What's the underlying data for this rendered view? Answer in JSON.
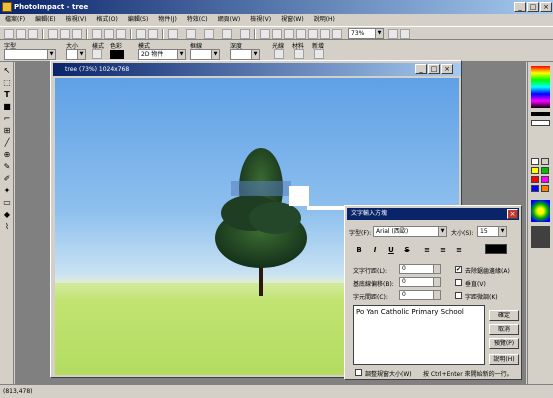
{
  "app": {
    "title": "PhotoImpact - tree",
    "menu": [
      "檔案(F)",
      "編輯(E)",
      "檢視(V)",
      "格式(O)",
      "編輯(S)",
      "物件(J)",
      "特效(C)",
      "網頁(W)",
      "檢視(V)",
      "視窗(W)",
      "說明(H)"
    ]
  },
  "toolbar": {
    "zoom": "73%"
  },
  "propbar": {
    "labels": [
      "字型",
      "大小",
      "樣式",
      "色彩",
      "模式",
      "框線",
      "深度",
      "光線",
      "材料",
      "新增"
    ],
    "mode_value": "2D 物件"
  },
  "document": {
    "title": "tree (73%) 1024x768"
  },
  "dialog": {
    "title": "文字輸入方塊",
    "font_label": "字型(F):",
    "font_value": "Arial (西歐)",
    "size_label": "大小(S):",
    "size_value": "15",
    "line_spacing_label": "文字行距(L):",
    "line_spacing_value": "0",
    "baseline_label": "基底線偏移(B):",
    "baseline_value": "0",
    "char_spacing_label": "字元間距(C):",
    "char_spacing_value": "0",
    "antialias_label": "去除鋸齒邊緣(A)",
    "antialias_checked": "✔",
    "vertical_label": "垂直(V)",
    "kerning_label": "字距微調(K)",
    "text": "Po Yan Catholic Primary School",
    "ok": "確定",
    "cancel": "取消",
    "preview": "預覽(P)",
    "help": "說明(H)",
    "resize_label": "調整規窗大小(W)",
    "hint": "按 Ctrl+Enter 來開始新的一行。",
    "accent": "#000000"
  },
  "status": {
    "coords": "(813,478)"
  }
}
